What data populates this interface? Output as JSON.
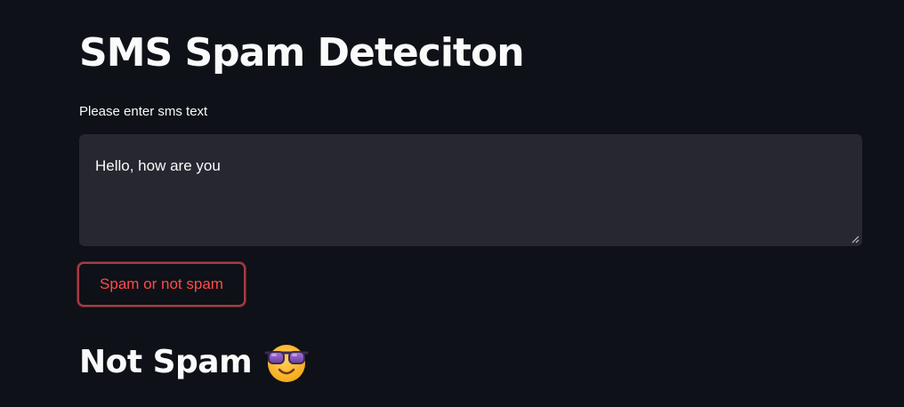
{
  "page": {
    "title": "SMS Spam Deteciton"
  },
  "form": {
    "label": "Please enter sms text",
    "textarea_value": "Hello, how are you",
    "button_label": "Spam or not spam"
  },
  "result": {
    "text": "Not Spam",
    "emoji_icon": "smiling-face-with-sunglasses-icon"
  },
  "colors": {
    "background": "#0e1117",
    "input_background": "#262730",
    "accent": "#ff4b4b",
    "text": "#fafafa"
  }
}
